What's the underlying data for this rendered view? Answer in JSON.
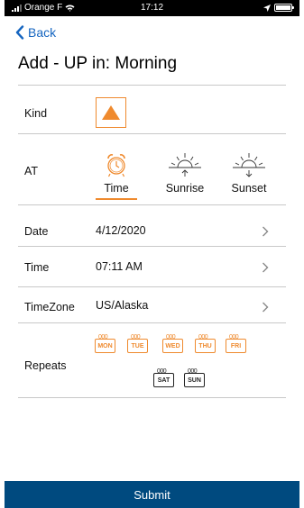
{
  "status_bar": {
    "carrier": "Orange F",
    "time": "17:12"
  },
  "nav": {
    "back_label": "Back"
  },
  "page": {
    "title": "Add - UP in: Morning"
  },
  "kind": {
    "label": "Kind",
    "selected_icon": "triangle-up-icon",
    "accent_color": "#ef8a2e"
  },
  "at": {
    "label": "AT",
    "options": [
      {
        "label": "Time",
        "icon": "alarm-clock-icon",
        "selected": true
      },
      {
        "label": "Sunrise",
        "icon": "sunrise-icon",
        "selected": false
      },
      {
        "label": "Sunset",
        "icon": "sunset-icon",
        "selected": false
      }
    ]
  },
  "date": {
    "label": "Date",
    "value": "4/12/2020"
  },
  "time": {
    "label": "Time",
    "value": "07:11 AM"
  },
  "timezone": {
    "label": "TimeZone",
    "value": "US/Alaska"
  },
  "repeats": {
    "label": "Repeats",
    "days": [
      {
        "label": "MON",
        "selected": true
      },
      {
        "label": "TUE",
        "selected": true
      },
      {
        "label": "WED",
        "selected": true
      },
      {
        "label": "THU",
        "selected": true
      },
      {
        "label": "FRI",
        "selected": true
      },
      {
        "label": "SAT",
        "selected": false
      },
      {
        "label": "SUN",
        "selected": false
      }
    ]
  },
  "submit": {
    "label": "Submit",
    "color": "#004a7f"
  }
}
